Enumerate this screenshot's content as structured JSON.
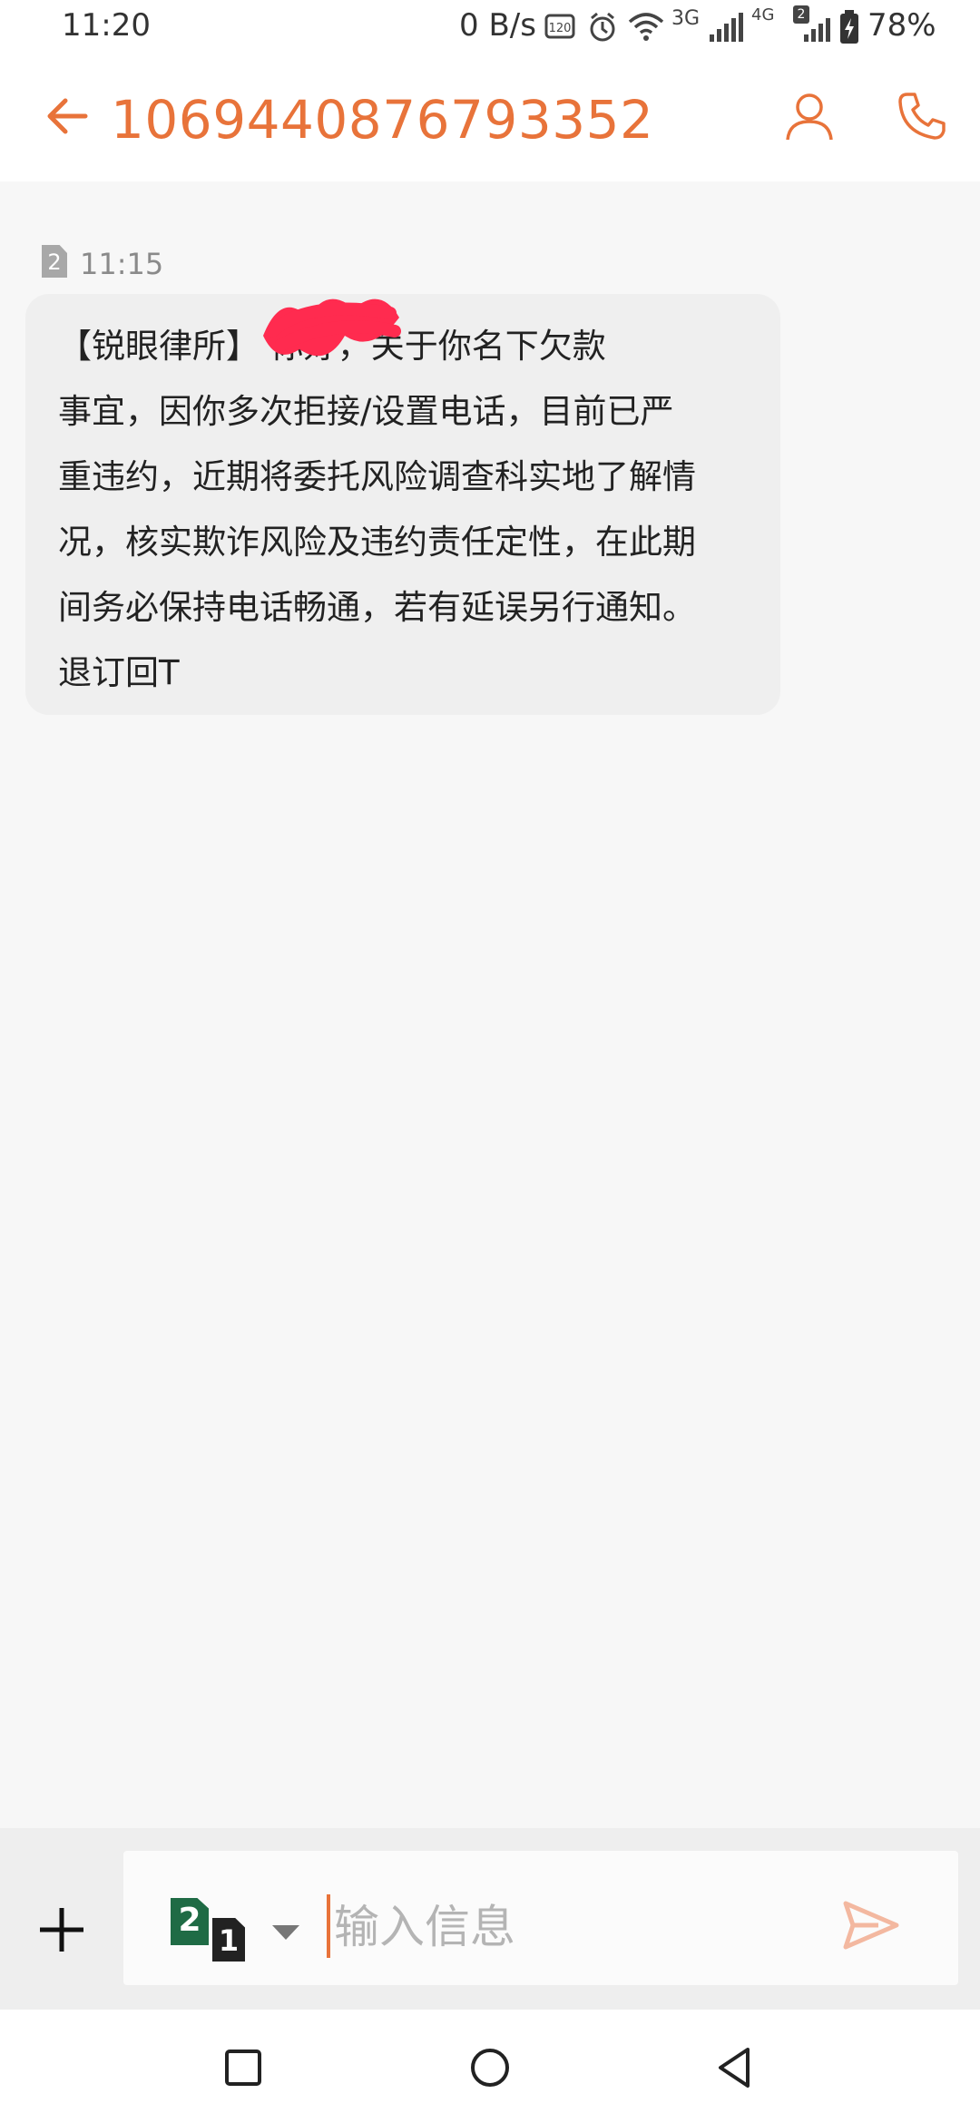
{
  "status_bar": {
    "time": "11:20",
    "net_speed": "0 B/s",
    "battery_percent": "78%",
    "icons": [
      "hd-icon",
      "alarm-icon",
      "wifi-icon",
      "signal-3g-icon",
      "signal-4g-hd-icon",
      "battery-charging-icon"
    ],
    "network_3g": "3G",
    "network_4g": "4G",
    "sim_badge": "2"
  },
  "header": {
    "title": "1069440876793352",
    "accent_color": "#e8733a"
  },
  "conversation": {
    "messages": [
      {
        "sim": "2",
        "time": "11:15",
        "lines": [
          "【锐眼律所】        你好，关于你名下欠款",
          "事宜，因你多次拒接/设置电话，目前已严",
          "重违约，近期将委托风险调查科实地了解情",
          "况，核实欺诈风险及违约责任定性，在此期",
          "间务必保持电话畅通，若有延误另行通知。",
          "退订回T"
        ]
      }
    ]
  },
  "input_bar": {
    "placeholder": "输入信息",
    "sim_primary": "2",
    "sim_secondary": "1"
  }
}
